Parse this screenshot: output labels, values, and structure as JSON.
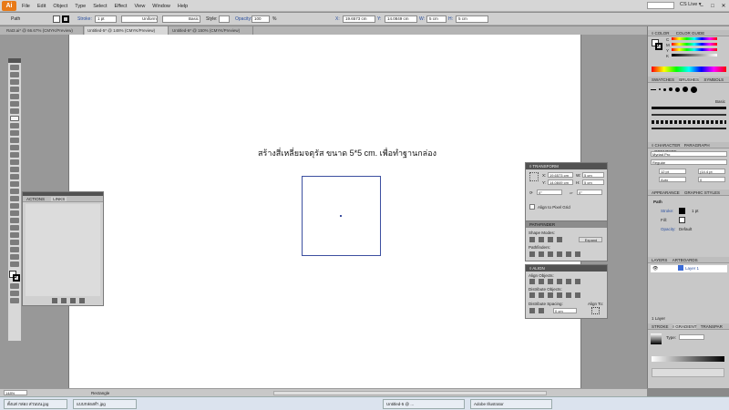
{
  "app": {
    "logo": "Ai"
  },
  "menu": [
    "File",
    "Edit",
    "Object",
    "Type",
    "Select",
    "Effect",
    "View",
    "Window",
    "Help"
  ],
  "app_bar": {
    "cs_live": "CS Live ▾"
  },
  "control": {
    "selection_type": "Path",
    "stroke_label": "Stroke:",
    "stroke_weight": "1 pt",
    "profile": "Uniform",
    "brush": "Basic",
    "style_label": "Style:",
    "opacity_label": "Opacity:",
    "opacity": "100",
    "opacity_unit": "%",
    "x_label": "X:",
    "x": "19.6573 cm",
    "y_label": "Y:",
    "y": "14.0849 cm",
    "w_label": "W:",
    "w": "5 cm",
    "h_label": "H:",
    "h": "5 cm"
  },
  "tabs": [
    "Rat3.ai* @ 66.67% (CMYK/Preview)",
    "Untitled-5* @ 148% (CMYK/Preview)",
    "Untitled-6* @ 150% (CMYK/Preview)"
  ],
  "canvas": {
    "heading": "สร้างสี่เหลี่ยมจตุรัส ขนาด 5*5 cm. เพื่อทำฐานกล่อง"
  },
  "actions_panel": {
    "tab1": "ACTIONS",
    "tab2": "LINKS"
  },
  "transform_panel": {
    "title": "◊ TRANSFORM",
    "x": "19.6573 cm",
    "y": "14.0849 cm",
    "w": "5 cm",
    "h": "5 cm",
    "rot": "0°",
    "shear": "0°",
    "align_pixel": "Align to Pixel Grid"
  },
  "pathfinder_panel": {
    "title": "PATHFINDER",
    "shape_modes": "Shape Modes:",
    "expand": "Expand",
    "pathfinders": "Pathfinders:"
  },
  "align_panel": {
    "title": "◊ ALIGN",
    "align_objects": "Align Objects:",
    "distribute_objects": "Distribute Objects:",
    "distribute_spacing": "Distribute Spacing:",
    "align_to": "Align To:",
    "spacing": "0 cm"
  },
  "color_panel": {
    "tab1": "◊ COLOR",
    "tab2": "COLOR GUIDE",
    "labels": [
      "C",
      "M",
      "Y",
      "K"
    ]
  },
  "swatches_panel": {
    "tab1": "SWATCHES",
    "tab2": "BRUSHES",
    "tab3": "SYMBOLS",
    "basic": "Basic"
  },
  "character_panel": {
    "tab1": "◊ CHARACTER",
    "tab2": "PARAGRAPH",
    "tab3": "OPENTYPE",
    "font": "Myriad Pro",
    "style": "Regular",
    "size": "12 pt",
    "leading": "(14.4 pt",
    "kerning": "Auto",
    "tracking": "0"
  },
  "appearance_panel": {
    "tab1": "APPEARANCE",
    "tab2": "GRAPHIC STYLES",
    "path": "Path",
    "stroke": "Stroke:",
    "stroke_val": "1 pt",
    "fill": "Fill:",
    "opacity": "Opacity:",
    "opacity_val": "Default"
  },
  "layers_panel": {
    "tab1": "LAYERS",
    "tab2": "ARTBOARDS",
    "layer": "Layer 1",
    "count": "1 Layer"
  },
  "gradient_panel": {
    "tab1": "STROKE",
    "tab2": "◊ GRADIENT",
    "tab3": "TRANSPAR",
    "type": "Type:"
  },
  "status": {
    "zoom": "148%",
    "tool": "Rectangle"
  },
  "taskbar": [
    "ตั้งแต่ กล่อง ส่วนบน.jpg",
    "แบบกล่องดำ.jpg",
    "Untitled-5 @ ...",
    "Adobe Illustrator"
  ]
}
